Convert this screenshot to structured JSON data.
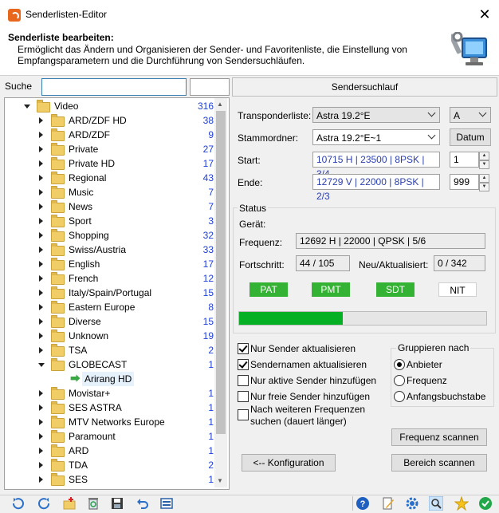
{
  "window": {
    "title": "Senderlisten-Editor",
    "close_glyph": "✕"
  },
  "header": {
    "title": "Senderliste bearbeiten:",
    "description": "Ermöglicht das Ändern und Organisieren der Sender- und Favoritenliste, die Einstellung von Empfangsparametern und die Durchführung von Sendersuchläufen."
  },
  "search": {
    "label": "Suche",
    "value": "",
    "secondary_value": ""
  },
  "tree": {
    "root": {
      "label": "Video",
      "count": "316"
    },
    "items": [
      {
        "label": "ARD/ZDF HD",
        "count": "38"
      },
      {
        "label": "ARD/ZDF",
        "count": "9"
      },
      {
        "label": "Private",
        "count": "27"
      },
      {
        "label": "Private HD",
        "count": "17"
      },
      {
        "label": "Regional",
        "count": "43"
      },
      {
        "label": "Music",
        "count": "7"
      },
      {
        "label": "News",
        "count": "7"
      },
      {
        "label": "Sport",
        "count": "3"
      },
      {
        "label": "Shopping",
        "count": "32"
      },
      {
        "label": "Swiss/Austria",
        "count": "33"
      },
      {
        "label": "English",
        "count": "17"
      },
      {
        "label": "French",
        "count": "12"
      },
      {
        "label": "Italy/Spain/Portugal",
        "count": "15"
      },
      {
        "label": "Eastern Europe",
        "count": "8"
      },
      {
        "label": "Diverse",
        "count": "15"
      },
      {
        "label": "Unknown",
        "count": "19"
      },
      {
        "label": "TSA",
        "count": "2"
      },
      {
        "label": "GLOBECAST",
        "count": "1"
      }
    ],
    "child": {
      "label": "Arirang  HD"
    },
    "items_after": [
      {
        "label": "Movistar+",
        "count": "1"
      },
      {
        "label": "SES ASTRA",
        "count": "1"
      },
      {
        "label": "MTV Networks Europe",
        "count": "1"
      },
      {
        "label": "Paramount",
        "count": "1"
      },
      {
        "label": "ARD",
        "count": "1"
      },
      {
        "label": "TDA",
        "count": "2"
      },
      {
        "label": "SES",
        "count": "1"
      }
    ]
  },
  "scan": {
    "section_title": "Sendersuchlauf",
    "transponder_label": "Transponderliste:",
    "transponder_value": "Astra 19.2°E",
    "transponder_letter": "A",
    "stamm_label": "Stammordner:",
    "stamm_value": "Astra 19.2°E~1",
    "datum_button": "Datum",
    "start_label": "Start:",
    "start_value": "10715 H | 23500 | 8PSK | 3/4",
    "start_spin": "1",
    "ende_label": "Ende:",
    "ende_value": "12729 V | 22000 | 8PSK | 2/3",
    "ende_spin": "999"
  },
  "status": {
    "title": "Status",
    "geraet_label": "Gerät:",
    "frequenz_label": "Frequenz:",
    "frequenz_value": "12692 H | 22000 | QPSK | 5/6",
    "fortschritt_label": "Fortschritt:",
    "fortschritt_value": "44 / 105",
    "neu_label": "Neu/Aktualisiert:",
    "neu_value": "0 / 342",
    "tags": [
      "PAT",
      "PMT",
      "SDT",
      "NIT"
    ],
    "progress": 0.42,
    "colors": {
      "active_tag": "#34b233",
      "progress": "#06b025"
    }
  },
  "options": {
    "checkboxes": [
      {
        "label": "Nur Sender aktualisieren",
        "checked": true
      },
      {
        "label": "Sendernamen aktualisieren",
        "checked": true
      },
      {
        "label": "Nur aktive Sender hinzufügen",
        "checked": false
      },
      {
        "label": "Nur freie Sender hinzufügen",
        "checked": false
      },
      {
        "label": "Nach weiteren Frequenzen",
        "label2": "suchen (dauert länger)",
        "checked": false
      }
    ],
    "group_title": "Gruppieren nach",
    "radios": [
      {
        "label": "Anbieter",
        "checked": true
      },
      {
        "label": "Frequenz",
        "checked": false
      },
      {
        "label": "Anfangsbuchstabe",
        "checked": false
      }
    ],
    "frequenz_scannen": "Frequenz scannen",
    "konfiguration": "<-- Konfiguration",
    "bereich_scannen": "Bereich scannen"
  },
  "toolbar": {
    "left_icons": [
      "refresh-icon",
      "reload-icon",
      "new-folder-icon",
      "recycle-icon",
      "save-icon",
      "undo-icon",
      "list-icon"
    ],
    "right_icons": [
      "help-icon",
      "edit-icon",
      "settings-icon",
      "search-icon",
      "favorite-star-icon",
      "confirm-check-icon"
    ]
  }
}
